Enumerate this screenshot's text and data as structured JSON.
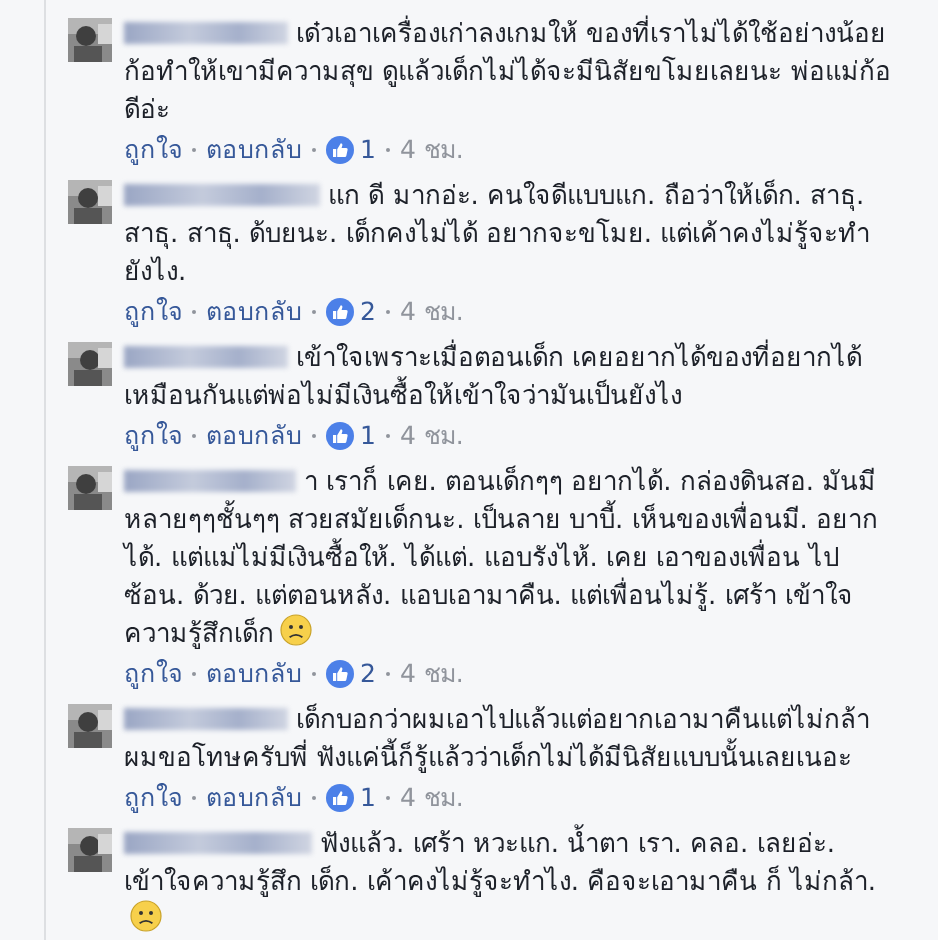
{
  "comments": [
    {
      "text": "เด๋วเอาเครื่องเก่าลงเกมให้ ของที่เราไม่ได้ใช้อย่างน้อยก้อทำให้เขามีความสุข ดูแล้วเด็กไม่ได้จะมีนิสัยขโมยเลยนะ พ่อแม่ก้อดีอ่ะ",
      "sad_emoji": false,
      "actions": {
        "like": "ถูกใจ",
        "reply": "ตอบกลับ",
        "reactions": "1",
        "time": "4 ชม."
      }
    },
    {
      "text": "แก ดี มากอ่ะ. คนใจดีแบบแก. ถือว่าให้เด็ก. สาธุ. สาธุ. สาธุ. ด้บยนะ. เด็กคงไม่ได้ อยากจะขโมย. แต่เค้าคงไม่รู้จะทำยังไง.",
      "sad_emoji": false,
      "actions": {
        "like": "ถูกใจ",
        "reply": "ตอบกลับ",
        "reactions": "2",
        "time": "4 ชม."
      }
    },
    {
      "text": "เข้าใจเพราะเมื่อตอนเด็ก เคยอยากได้ของที่อยากได้เหมือนกันแต่พ่อไม่มีเงินซื้อให้เข้าใจว่ามันเป็นยังไง",
      "sad_emoji": false,
      "actions": {
        "like": "ถูกใจ",
        "reply": "ตอบกลับ",
        "reactions": "1",
        "time": "4 ชม."
      }
    },
    {
      "text": "า เราก็ เคย. ตอนเด็กๆๆ อยากได้. กล่องดินสอ. มันมีหลายๆๆชั้นๆๆ สวยสมัยเด็กนะ. เป็นลาย บาบี้. เห็นของเพื่อนมี. อยากได้. แต่แม่ไม่มีเงินซื้อให้. ได้แต่. แอบรังไห้. เคย เอาของเพื่อน ไปซ้อน. ด้วย. แต่ตอนหลัง. แอบเอามาคืน. แต่เพื่อนไม่รู้. เศร้า เข้าใจความรู้สึกเด็ก",
      "sad_emoji": true,
      "actions": {
        "like": "ถูกใจ",
        "reply": "ตอบกลับ",
        "reactions": "2",
        "time": "4 ชม."
      }
    },
    {
      "text": "เด็กบอกว่าผมเอาไปแล้วแต่อยากเอามาคืนแต่ไม่กล้า ผมขอโทษครับพี่ ฟังแค่นี้ก็รู้แล้วว่าเด็กไม่ได้มีนิสัยแบบนั้นเลยเนอะ",
      "sad_emoji": false,
      "actions": {
        "like": "ถูกใจ",
        "reply": "ตอบกลับ",
        "reactions": "1",
        "time": "4 ชม."
      }
    },
    {
      "text": "ฟังแล้ว. เศร้า หวะแก. น้ำตา เรา. คลอ. เลยอ่ะ. เข้าใจความรู้สึก เด็ก. เค้าคงไม่รู้จะทำไง. คือจะเอามาคืน ก็ ไม่กล้า.",
      "sad_emoji": true
    }
  ]
}
